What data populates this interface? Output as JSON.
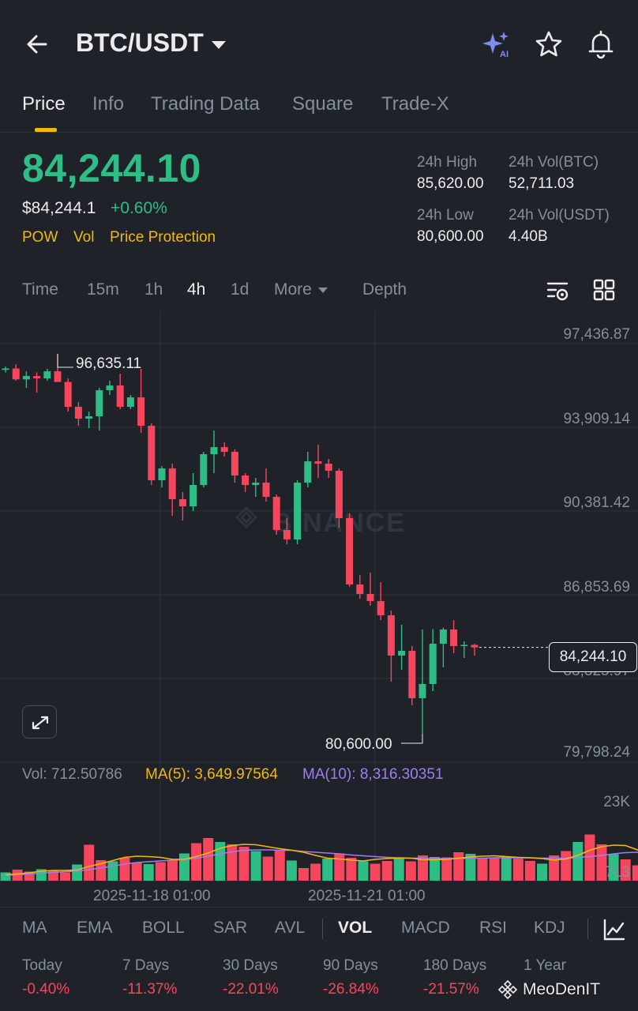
{
  "header": {
    "pair": "BTC/USDT",
    "icons": [
      "back-arrow-icon",
      "ai-sparkle-icon",
      "star-icon",
      "bell-icon"
    ]
  },
  "tabs": [
    {
      "label": "Price",
      "active": true
    },
    {
      "label": "Info"
    },
    {
      "label": "Trading Data"
    },
    {
      "label": "Square"
    },
    {
      "label": "Trade-X"
    }
  ],
  "ticker": {
    "last_price": "84,244.10",
    "usd_price": "$84,244.1",
    "change_pct": "+0.60%",
    "tags": [
      "POW",
      "Vol",
      "Price Protection"
    ],
    "stats": {
      "high_label": "24h High",
      "high_value": "85,620.00",
      "vol_btc_label": "24h Vol(BTC)",
      "vol_btc_value": "52,711.03",
      "low_label": "24h Low",
      "low_value": "80,600.00",
      "vol_usdt_label": "24h Vol(USDT)",
      "vol_usdt_value": "4.40B"
    }
  },
  "timeframes": {
    "items": [
      "Time",
      "15m",
      "1h",
      "4h",
      "1d"
    ],
    "active": "4h",
    "more_label": "More",
    "depth_label": "Depth"
  },
  "chart_data": {
    "type": "candlestick",
    "symbol": "BTC/USDT",
    "interval": "4h",
    "y_axis_ticks": [
      "97,436.87",
      "93,909.14",
      "90,381.42",
      "86,853.69",
      "83,325.97",
      "79,798.24"
    ],
    "ylim": [
      79798.24,
      97436.87
    ],
    "x_axis_ticks": [
      "2025-11-18 01:00",
      "2025-11-21 01:00"
    ],
    "max_label": "96,635.11",
    "min_label": "80,600.00",
    "current_price_label": "84,244.10",
    "watermark": "BINANCE",
    "candles": [
      [
        95960,
        96100,
        95850,
        96020
      ],
      [
        96020,
        96200,
        95500,
        95560
      ],
      [
        95560,
        95900,
        95200,
        95700
      ],
      [
        95700,
        95850,
        95000,
        95600
      ],
      [
        95600,
        96000,
        95500,
        95900
      ],
      [
        95900,
        96635.11,
        95700,
        95450
      ],
      [
        95450,
        95600,
        94200,
        94400
      ],
      [
        94400,
        94600,
        93600,
        93900
      ],
      [
        93900,
        94200,
        93500,
        94000
      ],
      [
        94000,
        95200,
        93400,
        95100
      ],
      [
        95100,
        95500,
        94900,
        95300
      ],
      [
        95300,
        95800,
        94300,
        94400
      ],
      [
        94400,
        94900,
        94300,
        94800
      ],
      [
        94800,
        96000,
        93300,
        93600
      ],
      [
        93600,
        93700,
        91100,
        91300
      ],
      [
        91300,
        91900,
        91000,
        91800
      ],
      [
        91800,
        92000,
        89800,
        90500
      ],
      [
        90500,
        90800,
        89600,
        90200
      ],
      [
        90200,
        91600,
        90000,
        91100
      ],
      [
        91100,
        92500,
        91000,
        92400
      ],
      [
        92400,
        93400,
        91600,
        92700
      ],
      [
        92700,
        92900,
        92300,
        92500
      ],
      [
        92500,
        92600,
        91200,
        91500
      ],
      [
        91500,
        91600,
        90800,
        91100
      ],
      [
        91100,
        91400,
        90600,
        91200
      ],
      [
        91200,
        91800,
        90400,
        90600
      ],
      [
        90600,
        90700,
        89000,
        89200
      ],
      [
        89200,
        89700,
        88600,
        88800
      ],
      [
        88800,
        91300,
        88600,
        91200
      ],
      [
        91200,
        92500,
        91000,
        92100
      ],
      [
        92100,
        92800,
        91400,
        92000
      ],
      [
        92000,
        92200,
        91400,
        91700
      ],
      [
        91700,
        91800,
        89300,
        89700
      ],
      [
        89700,
        89900,
        86800,
        86900
      ],
      [
        86900,
        87300,
        86300,
        86500
      ],
      [
        86500,
        87400,
        86000,
        86200
      ],
      [
        86200,
        87000,
        85400,
        85600
      ],
      [
        85600,
        85800,
        82800,
        83900
      ],
      [
        83900,
        85200,
        83300,
        84100
      ],
      [
        84100,
        84300,
        81800,
        82100
      ],
      [
        82100,
        85000,
        80600,
        82700
      ],
      [
        82700,
        85020,
        82400,
        84400
      ],
      [
        84400,
        85080,
        83400,
        85000
      ],
      [
        85000,
        85390,
        84000,
        84300
      ],
      [
        84300,
        84500,
        83800,
        84350
      ],
      [
        84350,
        84400,
        83900,
        84244.1
      ]
    ],
    "volume": {
      "label_vol": "Vol: 712.50786",
      "label_ma5": "MA(5): 3,649.97564",
      "label_ma10": "MA(10): 8,316.30351",
      "axis_top": "23K",
      "axis_bottom": "713",
      "max": 23000,
      "values": [
        2100,
        2800,
        2300,
        2900,
        2600,
        2100,
        4100,
        9100,
        5200,
        4900,
        5800,
        4600,
        4200,
        4700,
        5100,
        6900,
        9500,
        10800,
        9800,
        9200,
        8600,
        7500,
        6100,
        7700,
        5100,
        3200,
        4300,
        5600,
        6900,
        5800,
        4900,
        4300,
        5000,
        5900,
        4900,
        6400,
        6000,
        5900,
        7200,
        6800,
        5600,
        5800,
        6000,
        5600,
        5000,
        4300,
        6400,
        7500,
        9800,
        11700,
        9200,
        6700,
        5400,
        3900,
        2700,
        1500,
        700
      ],
      "colors": "gr",
      "ma5": [
        1500,
        1700,
        2000,
        2400,
        2600,
        2600,
        2700,
        3600,
        4300,
        5100,
        5900,
        6200,
        6100,
        5900,
        5400,
        5400,
        6100,
        7000,
        8200,
        8900,
        9200,
        9100,
        8600,
        8100,
        7700,
        7200,
        6400,
        5700,
        5500,
        5200,
        5000,
        5400,
        5600,
        5700,
        5700,
        5300,
        5300,
        5400,
        5700,
        6000,
        6200,
        6300,
        6100,
        5900,
        5800,
        5600,
        5200,
        5500,
        6400,
        7700,
        8600,
        9000,
        8900,
        7800,
        6300,
        4500,
        2800
      ],
      "ma10": [
        1400,
        1500,
        1700,
        1900,
        2100,
        2300,
        2400,
        2800,
        3200,
        3700,
        4200,
        4600,
        4800,
        5000,
        5200,
        5300,
        5700,
        6200,
        6800,
        7300,
        7700,
        7800,
        7800,
        7700,
        7700,
        7400,
        7200,
        7000,
        6800,
        6500,
        6300,
        6100,
        5900,
        5800,
        5700,
        5700,
        5600,
        5600,
        5600,
        5700,
        5700,
        5800,
        5800,
        5800,
        5800,
        5700,
        5700,
        5700,
        5900,
        6100,
        6400,
        6800,
        7100,
        7200,
        7100,
        6700,
        5900
      ]
    }
  },
  "indicators": {
    "items": [
      "MA",
      "EMA",
      "BOLL",
      "SAR",
      "AVL",
      "VOL",
      "MACD",
      "RSI",
      "KDJ"
    ],
    "active": "VOL"
  },
  "performance": [
    {
      "label": "Today",
      "value": "-0.40%"
    },
    {
      "label": "7 Days",
      "value": "-11.37%"
    },
    {
      "label": "30 Days",
      "value": "-22.01%"
    },
    {
      "label": "90 Days",
      "value": "-26.84%"
    },
    {
      "label": "180 Days",
      "value": "-21.57%"
    },
    {
      "label": "1 Year",
      "value": ""
    }
  ],
  "watermark_text": "MeoDenIT",
  "colors": {
    "up": "#2ebd85",
    "down": "#f6465d",
    "accent": "#f0b90b",
    "ma5": "#f0b90b",
    "ma10": "#a07cf0",
    "bg": "#1f2329"
  }
}
